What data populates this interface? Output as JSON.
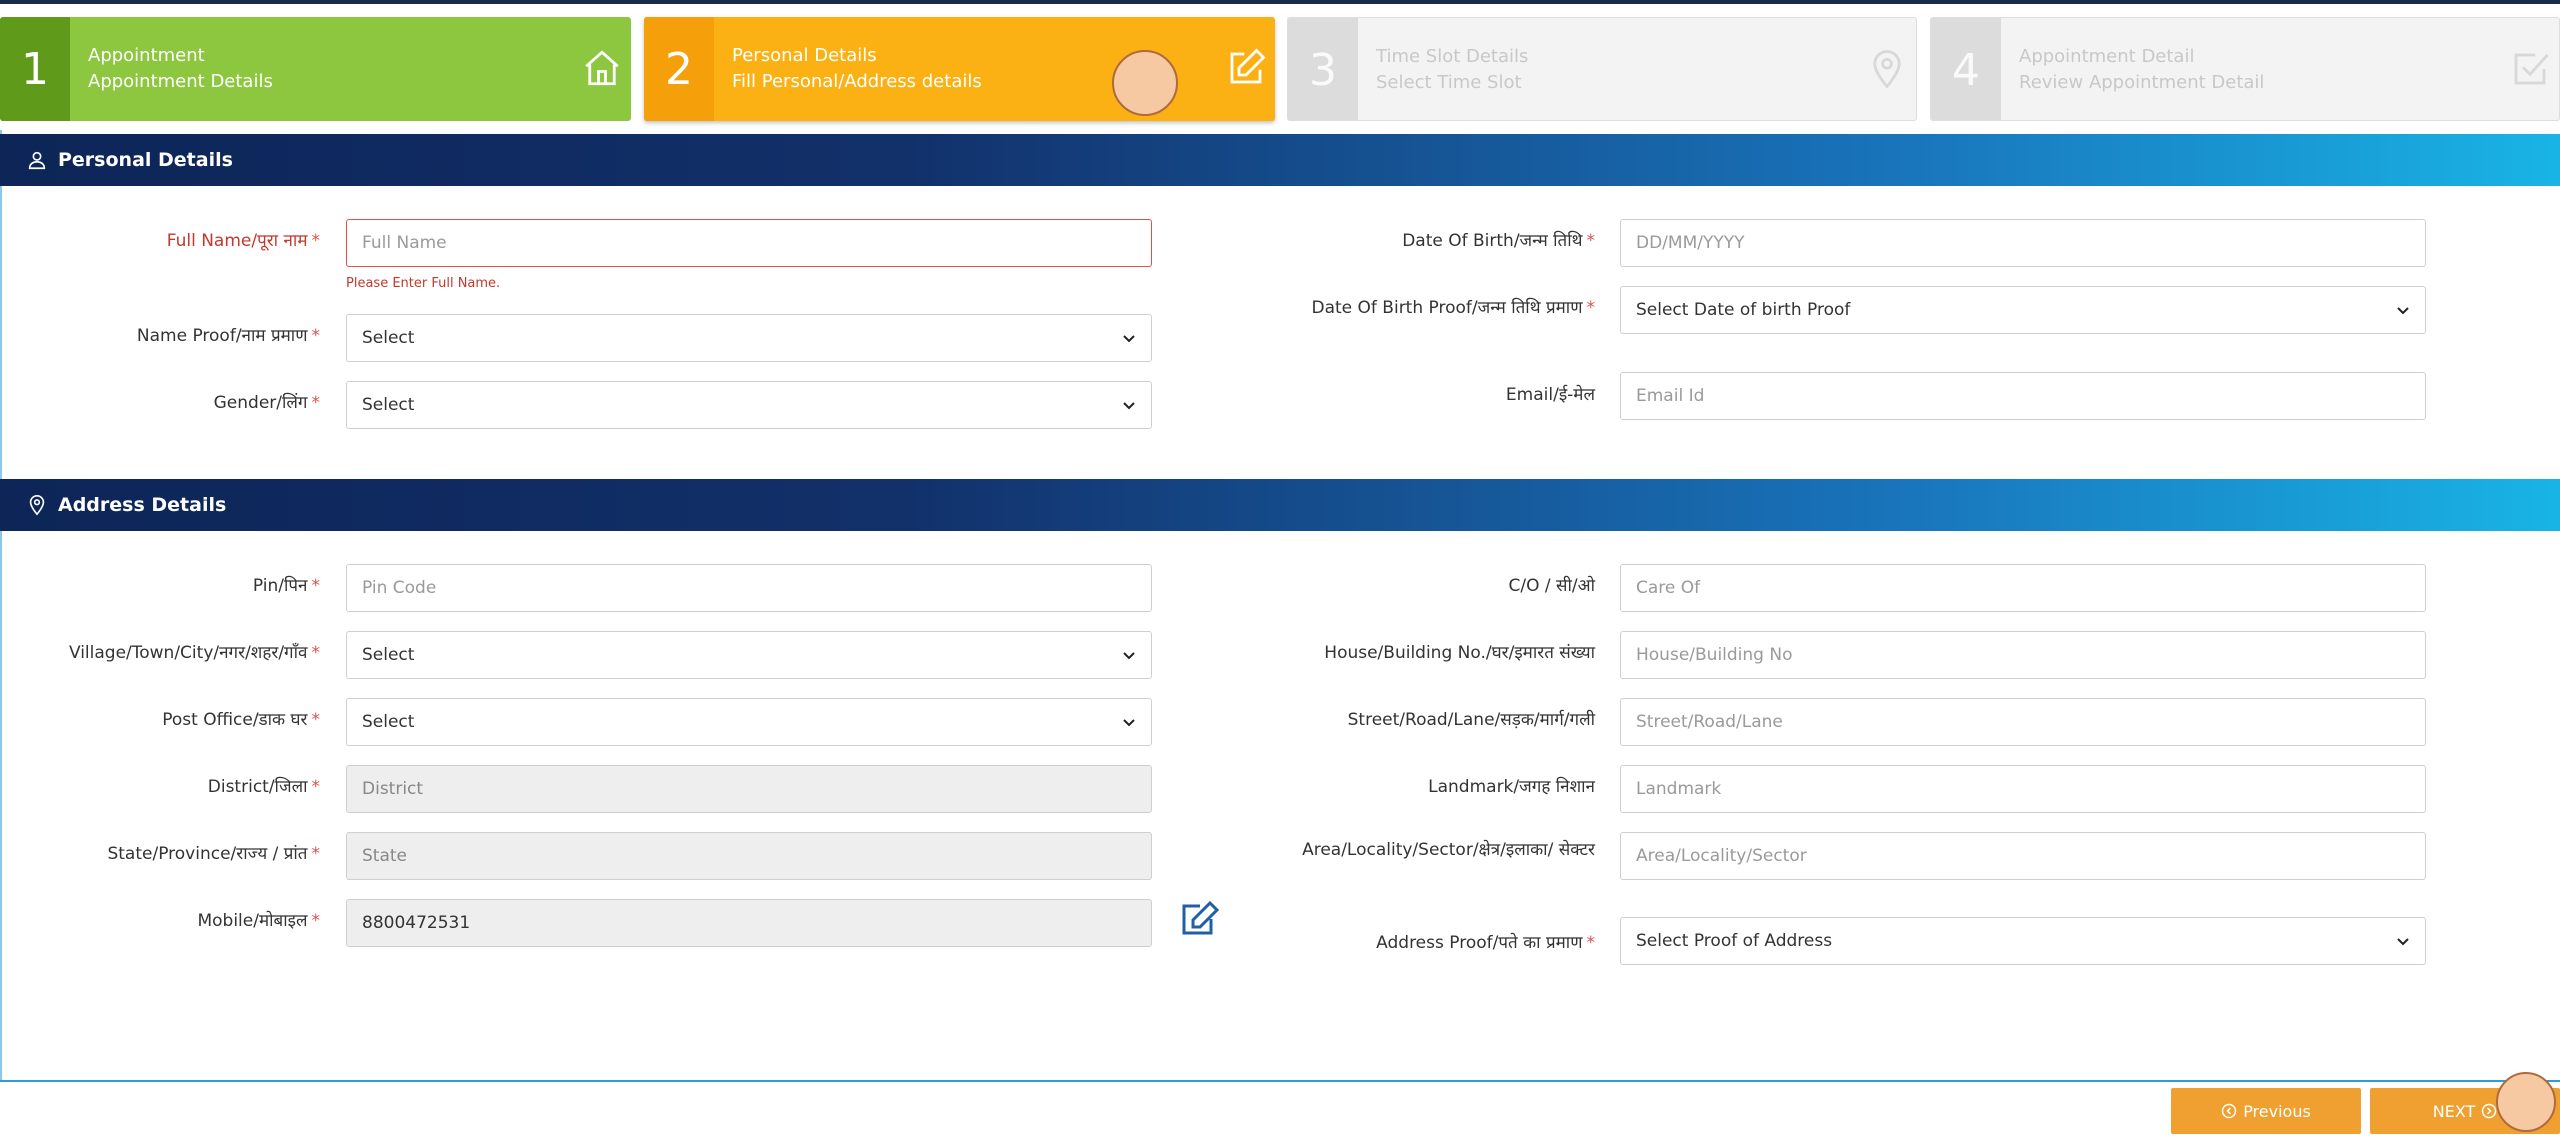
{
  "steps": [
    {
      "num": "1",
      "title": "Appointment",
      "subtitle": "Appointment Details",
      "icon": "home-icon"
    },
    {
      "num": "2",
      "title": "Personal Details",
      "subtitle": "Fill Personal/Address details",
      "icon": "edit-icon"
    },
    {
      "num": "3",
      "title": "Time Slot Details",
      "subtitle": "Select Time Slot",
      "icon": "map-pin-icon"
    },
    {
      "num": "4",
      "title": "Appointment Detail",
      "subtitle": "Review Appointment Detail",
      "icon": "checkbox-icon"
    }
  ],
  "personal": {
    "heading": "Personal Details",
    "full_name": {
      "label": "Full Name/पूरा नाम",
      "placeholder": "Full Name",
      "error": "Please Enter Full Name."
    },
    "name_proof": {
      "label": "Name Proof/नाम प्रमाण",
      "value": "Select"
    },
    "gender": {
      "label": "Gender/लिंग",
      "value": "Select"
    },
    "dob": {
      "label": "Date Of Birth/जन्म तिथि",
      "placeholder": "DD/MM/YYYY"
    },
    "dob_proof": {
      "label": "Date Of Birth Proof/जन्म तिथि प्रमाण",
      "value": "Select Date of birth Proof"
    },
    "email": {
      "label": "Email/ई-मेल",
      "placeholder": "Email Id"
    }
  },
  "address": {
    "heading": "Address Details",
    "pin": {
      "label": "Pin/पिन",
      "placeholder": "Pin Code"
    },
    "village": {
      "label": "Village/Town/City/नगर/शहर/गाँव",
      "value": "Select"
    },
    "post_office": {
      "label": "Post Office/डाक घर",
      "value": "Select"
    },
    "district": {
      "label": "District/जिला",
      "placeholder": "District"
    },
    "state": {
      "label": "State/Province/राज्य / प्रांत",
      "placeholder": "State"
    },
    "mobile": {
      "label": "Mobile/मोबाइल",
      "value": "8800472531"
    },
    "care_of": {
      "label": "C/O / सी/ओ",
      "placeholder": "Care Of"
    },
    "house": {
      "label": "House/Building No./घर/इमारत संख्या",
      "placeholder": "House/Building No"
    },
    "street": {
      "label": "Street/Road/Lane/सड़क/मार्ग/गली",
      "placeholder": "Street/Road/Lane"
    },
    "landmark": {
      "label": "Landmark/जगह निशान",
      "placeholder": "Landmark"
    },
    "area": {
      "label": "Area/Locality/Sector/क्षेत्र/इलाका/ सेक्टर",
      "placeholder": "Area/Locality/Sector"
    },
    "address_proof": {
      "label": "Address Proof/पते का प्रमाण",
      "value": "Select Proof of Address"
    }
  },
  "footer": {
    "previous": "Previous",
    "next": "NEXT"
  },
  "colors": {
    "step_done": "#8dc63f",
    "step_active": "#fbb114",
    "header_dark": "#0d2557",
    "header_light": "#19b4e6",
    "button": "#f0a030"
  }
}
